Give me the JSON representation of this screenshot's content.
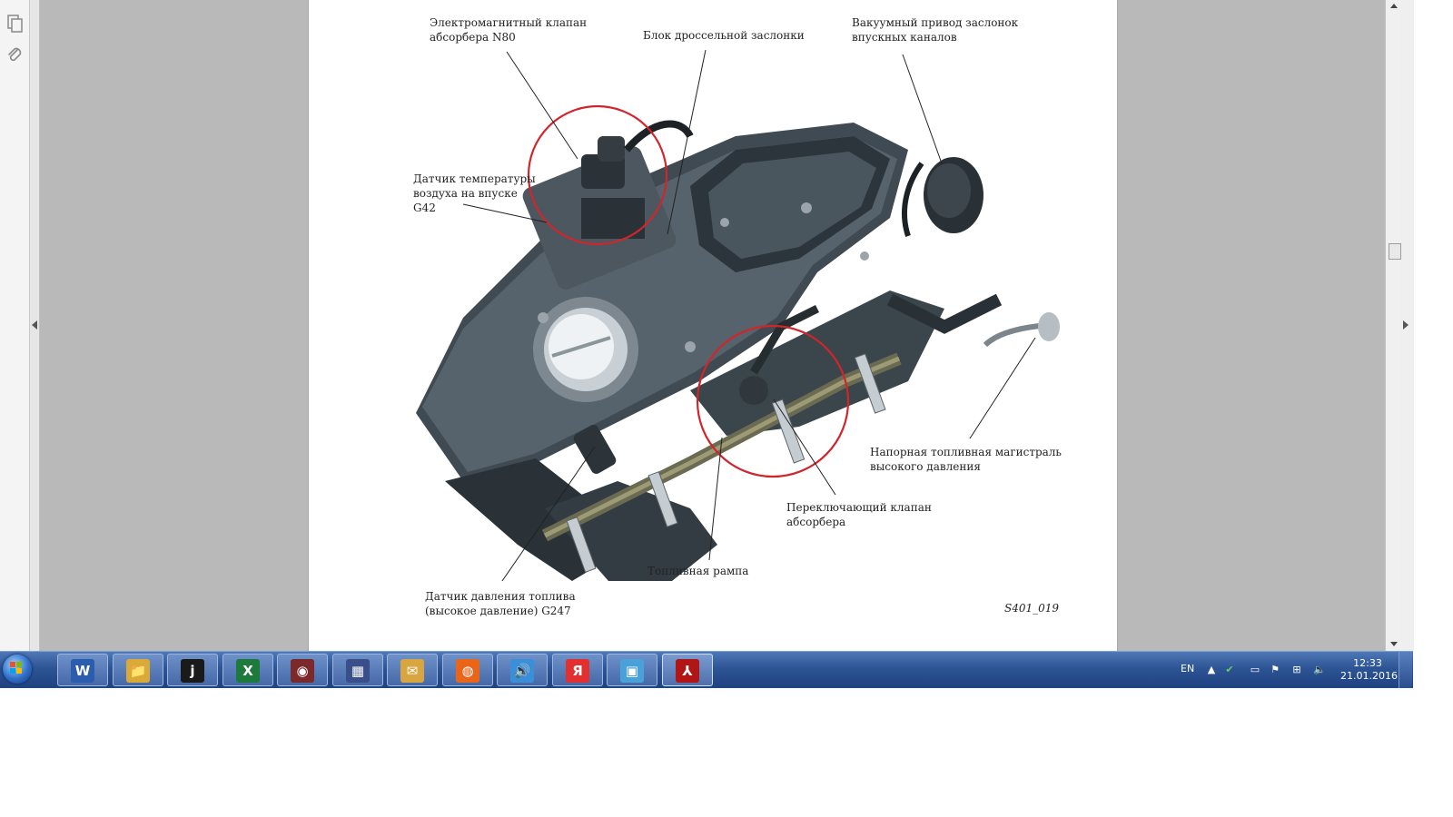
{
  "viewer": {
    "left_tools": [
      {
        "name": "pages-icon",
        "glyph": "⧉"
      },
      {
        "name": "attachment-icon",
        "glyph": "🖇"
      }
    ]
  },
  "figure": {
    "labels": {
      "absorber_valve_n80": [
        "Электромагнитный клапан",
        "абсорбера N80"
      ],
      "throttle_block": [
        "Блок дроссельной заслонки"
      ],
      "vacuum_actuator": [
        "Вакуумный привод заслонок",
        "впускных каналов"
      ],
      "intake_temp_sensor": [
        "Датчик температуры",
        "воздуха на впуске",
        "G42"
      ],
      "high_pressure_line": [
        "Напорная топливная магистраль",
        "высокого давления"
      ],
      "absorber_switch_valve": [
        "Переключающий клапан",
        "абсорбера"
      ],
      "fuel_rail": [
        "Топливная рампа"
      ],
      "fuel_pressure_sensor": [
        "Датчик давления топлива",
        "(высокое давление) G247"
      ]
    },
    "figure_id": "S401_019",
    "highlight_color": "#d0262b"
  },
  "taskbar": {
    "apps": [
      {
        "name": "word",
        "glyph": "W",
        "color": "#2b5cad"
      },
      {
        "name": "file-explorer",
        "glyph": "📁",
        "color": "#d9a93a"
      },
      {
        "name": "j-app",
        "glyph": "j",
        "color": "#1a1a1a"
      },
      {
        "name": "excel",
        "glyph": "X",
        "color": "#1e7a3c"
      },
      {
        "name": "media-app",
        "glyph": "◉",
        "color": "#7a2a2a"
      },
      {
        "name": "network-app",
        "glyph": "▦",
        "color": "#3a4f8a"
      },
      {
        "name": "mail-app",
        "glyph": "✉",
        "color": "#d8a640"
      },
      {
        "name": "firefox",
        "glyph": "◍",
        "color": "#e8651a"
      },
      {
        "name": "sound-app",
        "glyph": "🔊",
        "color": "#3b8fd8"
      },
      {
        "name": "yandex",
        "glyph": "Я",
        "color": "#e23030"
      },
      {
        "name": "image-viewer",
        "glyph": "▣",
        "color": "#4aa0d8"
      },
      {
        "name": "adobe-reader",
        "glyph": "⅄",
        "color": "#b01616"
      }
    ],
    "tray": {
      "language": "EN",
      "time": "12:33",
      "date": "21.01.2016",
      "icons": [
        "show-hidden-icon",
        "security-icon",
        "network-icon",
        "flag-icon",
        "windows-icon",
        "volume-icon"
      ]
    }
  }
}
